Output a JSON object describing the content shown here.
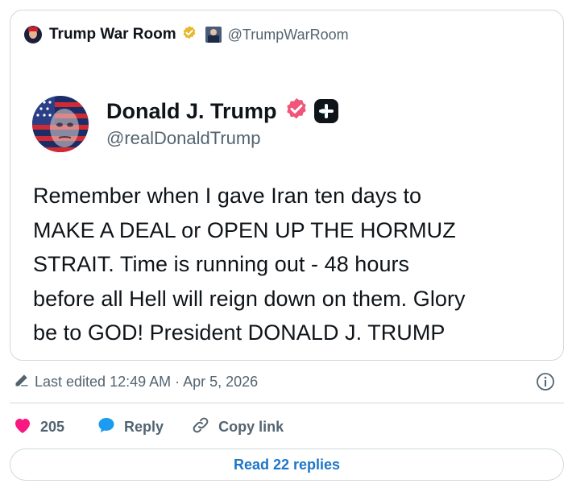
{
  "header": {
    "name": "Trump War Room",
    "handle": "@TrumpWarRoom"
  },
  "post": {
    "author_name": "Donald J. Trump",
    "author_handle": "@realDonaldTrump",
    "lines": [
      "Remember when I gave Iran ten days to",
      "MAKE A DEAL or OPEN UP THE HORMUZ",
      "STRAIT. Time is running out - 48 hours",
      "before all Hell will reign down on them. Glory",
      "be to GOD! President DONALD J. TRUMP"
    ]
  },
  "meta": {
    "edited": "Last edited 12:49 AM · Apr 5, 2026"
  },
  "actions": {
    "likes": "205",
    "reply_label": "Reply",
    "copy_label": "Copy link"
  },
  "read_replies": "Read 22 replies",
  "colors": {
    "like": "#f91880",
    "reply": "#1d9bf0",
    "link": "#1d75c9",
    "verified_gold": "#e8b829",
    "verified_pink": "#f0567a"
  },
  "icons": [
    "gold-verified-badge-icon",
    "pink-verified-badge-icon",
    "plus-icon",
    "pencil-icon",
    "info-icon",
    "heart-icon",
    "speech-bubble-icon",
    "link-icon"
  ]
}
